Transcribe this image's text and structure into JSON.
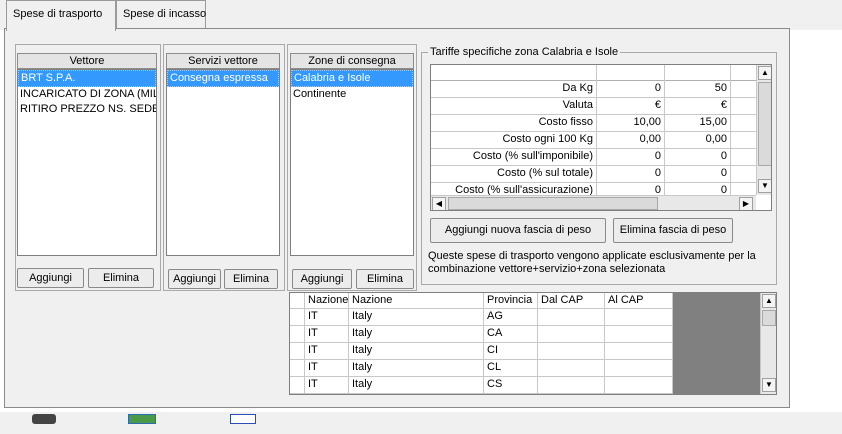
{
  "tabs": [
    "Spese di trasporto",
    "Spese di incasso"
  ],
  "vettore": {
    "header": "Vettore",
    "items": [
      "BRT S.P.A.",
      "INCARICATO DI ZONA (MIL",
      "RITIRO PREZZO NS. SEDE"
    ],
    "add": "Aggiungi",
    "remove": "Elimina"
  },
  "servizi": {
    "header": "Servizi vettore",
    "items": [
      "Consegna espressa"
    ],
    "add": "Aggiungi",
    "remove": "Elimina"
  },
  "zone": {
    "header": "Zone di consegna",
    "items": [
      "Calabria e Isole",
      "Continente"
    ],
    "add": "Aggiungi",
    "remove": "Elimina"
  },
  "tariffe": {
    "title": "Tariffe specifiche zona Calabria e Isole",
    "rows": [
      {
        "label": "Da Kg",
        "v1": "0",
        "v2": "50"
      },
      {
        "label": "Valuta",
        "v1": "€",
        "v2": "€"
      },
      {
        "label": "Costo fisso",
        "v1": "10,00",
        "v2": "15,00"
      },
      {
        "label": "Costo ogni 100 Kg",
        "v1": "0,00",
        "v2": "0,00"
      },
      {
        "label": "Costo (% sull'imponibile)",
        "v1": "0",
        "v2": "0"
      },
      {
        "label": "Costo (% sul totale)",
        "v1": "0",
        "v2": "0"
      },
      {
        "label": "Costo (% sull'assicurazione)",
        "v1": "0",
        "v2": "0"
      }
    ],
    "add_band": "Aggiungi nuova fascia di peso",
    "remove_band": "Elimina fascia di peso",
    "note_line1": "Queste spese di trasporto vengono applicate esclusivamente per la",
    "note_line2": "combinazione vettore+servizio+zona selezionata"
  },
  "provinces": {
    "columns": [
      "Nazione",
      "Nazione",
      "Provincia",
      "Dal CAP",
      "Al CAP"
    ],
    "rows": [
      {
        "code": "IT",
        "country": "Italy",
        "prov": "AG"
      },
      {
        "code": "IT",
        "country": "Italy",
        "prov": "CA"
      },
      {
        "code": "IT",
        "country": "Italy",
        "prov": "CI"
      },
      {
        "code": "IT",
        "country": "Italy",
        "prov": "CL"
      },
      {
        "code": "IT",
        "country": "Italy",
        "prov": "CS"
      }
    ]
  },
  "colors": {
    "selection": "#3399ff",
    "window": "#f0f0f0",
    "grid_empty": "#808080"
  }
}
